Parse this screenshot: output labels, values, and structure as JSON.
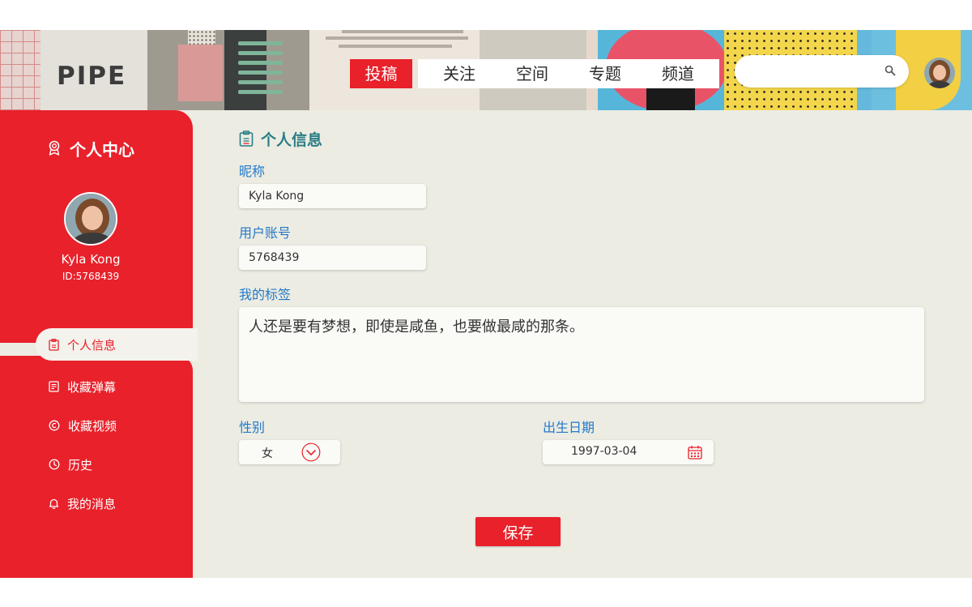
{
  "header": {
    "logo": "PIPE",
    "nav_active": "投稿",
    "nav_tabs": [
      "关注",
      "空间",
      "专题",
      "频道"
    ],
    "search_placeholder": "",
    "search_icon": "search-icon"
  },
  "sidebar": {
    "title": "个人中心",
    "title_icon": "award-icon",
    "user_name": "Kyla Kong",
    "user_id": "ID:5768439",
    "menu": [
      {
        "label": "个人信息",
        "icon": "clipboard-icon",
        "active": true
      },
      {
        "label": "收藏弹幕",
        "icon": "document-icon",
        "active": false
      },
      {
        "label": "收藏视频",
        "icon": "copyright-icon",
        "active": false
      },
      {
        "label": "历史",
        "icon": "clock-icon",
        "active": false
      },
      {
        "label": "我的消息",
        "icon": "bell-icon",
        "active": false
      }
    ]
  },
  "main": {
    "title": "个人信息",
    "nickname_label": "昵称",
    "nickname_value": "Kyla Kong",
    "account_label": "用户账号",
    "account_value": "5768439",
    "tags_label": "我的标签",
    "tags_value": "人还是要有梦想，即使是咸鱼，也要做最咸的那条。",
    "gender_label": "性别",
    "gender_value": "女",
    "dob_label": "出生日期",
    "dob_value": "1997-03-04",
    "save_label": "保存"
  },
  "colors": {
    "accent": "#e8212b",
    "background": "#ecece3",
    "label": "#2479c7",
    "title": "#2a7d84"
  }
}
